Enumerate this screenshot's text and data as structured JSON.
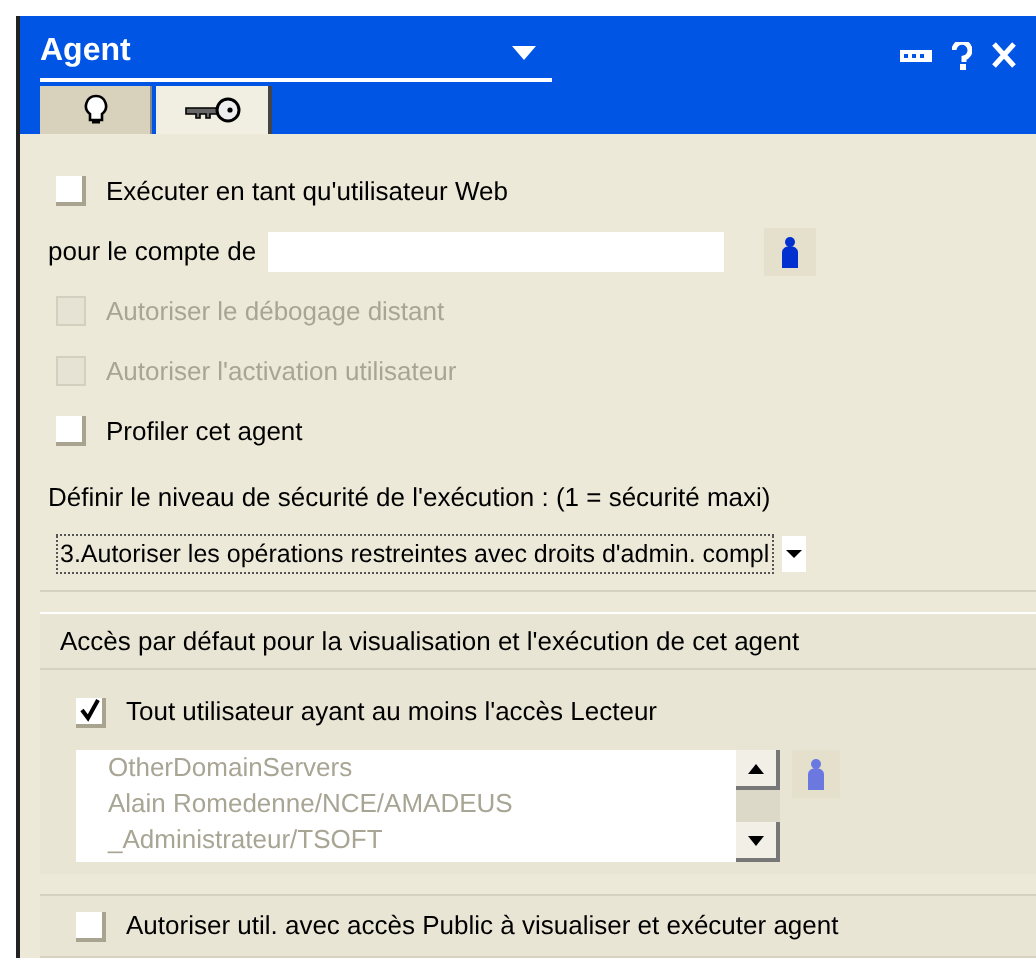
{
  "window": {
    "title": "Agent"
  },
  "tabs": [
    {
      "kind": "bulb",
      "selected": false
    },
    {
      "kind": "key",
      "selected": true
    }
  ],
  "run_as_web_user": {
    "label": "Exécuter en tant qu'utilisateur Web",
    "checked": false,
    "disabled": false
  },
  "account": {
    "label": "pour le compte de"
  },
  "options": [
    {
      "label": "Autoriser le débogage distant",
      "checked": false,
      "disabled": true
    },
    {
      "label": "Autoriser l'activation utilisateur",
      "checked": false,
      "disabled": true
    },
    {
      "label": "Profiler cet agent",
      "checked": false,
      "disabled": false
    }
  ],
  "security": {
    "label": "Définir le niveau de sécurité de l'exécution : (1 = sécurité maxi)",
    "value": "3.Autoriser les opérations restreintes avec droits d'admin. compl"
  },
  "default_access": {
    "heading": "Accès par défaut pour la visualisation et l'exécution de cet agent",
    "all_readers": {
      "label": "Tout utilisateur ayant au moins l'accès Lecteur",
      "checked": true,
      "disabled": false
    },
    "users": [
      "OtherDomainServers",
      "Alain Romedenne/NCE/AMADEUS",
      "_Administrateur/TSOFT"
    ]
  },
  "public_access": {
    "label": "Autoriser util. avec accès Public à visualiser et exécuter agent",
    "checked": false,
    "disabled": false
  }
}
